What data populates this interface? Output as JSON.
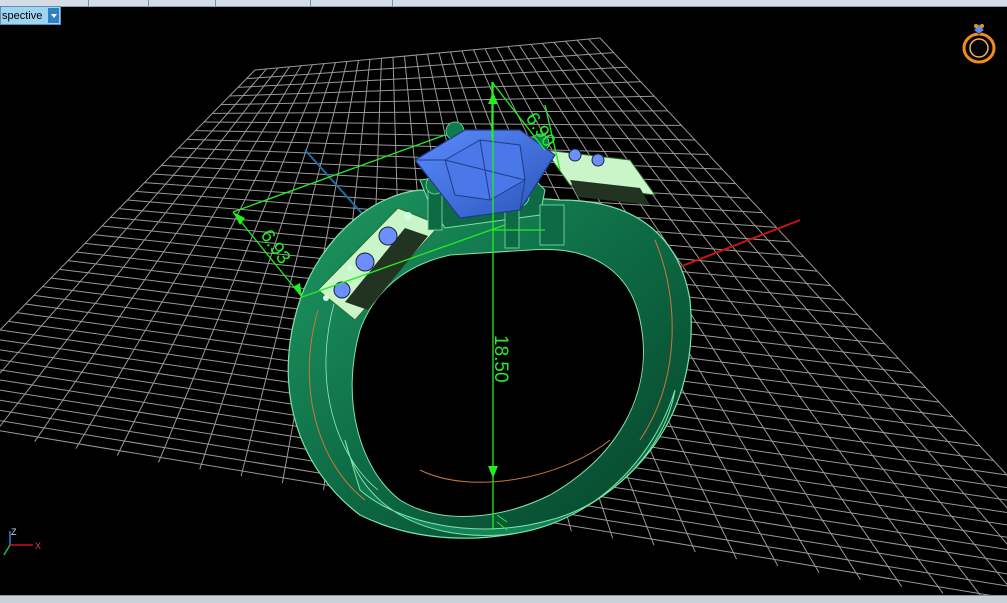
{
  "toolbar": {
    "view_dropdown_label": "spective"
  },
  "dimensions": {
    "width_top": "6.90",
    "width_side": "6.93",
    "height": "18.50"
  },
  "axes": {
    "z_label": "Z",
    "x_label": "X"
  },
  "icons": {
    "navigator": "ring-navigator-icon",
    "dropdown_arrow": "chevron-down-icon"
  },
  "colors": {
    "background": "#000000",
    "grid": "#b4b4b4",
    "ring_metal": "#0d6a44",
    "stone": "#3a6fd8",
    "dimension": "#22ee22",
    "axis_x": "#c81414",
    "axis_y": "#1a6fa8"
  }
}
